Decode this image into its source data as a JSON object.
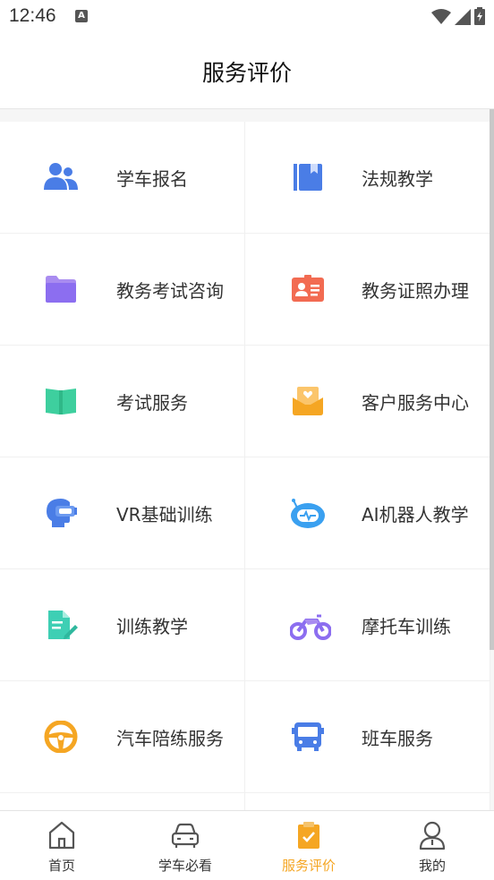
{
  "status_bar": {
    "time": "12:46",
    "badge": "A"
  },
  "header": {
    "title": "服务评价"
  },
  "services": [
    {
      "label": "学车报名",
      "icon": "users-icon"
    },
    {
      "label": "法规教学",
      "icon": "book-icon"
    },
    {
      "label": "教务考试咨询",
      "icon": "folder-icon"
    },
    {
      "label": "教务证照办理",
      "icon": "id-card-icon"
    },
    {
      "label": "考试服务",
      "icon": "open-book-icon"
    },
    {
      "label": "客户服务中心",
      "icon": "inbox-heart-icon"
    },
    {
      "label": "VR基础训练",
      "icon": "vr-headset-icon"
    },
    {
      "label": "AI机器人教学",
      "icon": "robot-icon"
    },
    {
      "label": "训练教学",
      "icon": "document-edit-icon"
    },
    {
      "label": "摩托车训练",
      "icon": "motorcycle-icon"
    },
    {
      "label": "汽车陪练服务",
      "icon": "steering-wheel-icon"
    },
    {
      "label": "班车服务",
      "icon": "bus-icon"
    }
  ],
  "tabbar": {
    "items": [
      {
        "label": "首页",
        "icon": "home-icon"
      },
      {
        "label": "学车必看",
        "icon": "car-icon"
      },
      {
        "label": "服务评价",
        "icon": "clipboard-check-icon",
        "active": true
      },
      {
        "label": "我的",
        "icon": "user-icon"
      }
    ],
    "active_color": "#f5a623"
  }
}
